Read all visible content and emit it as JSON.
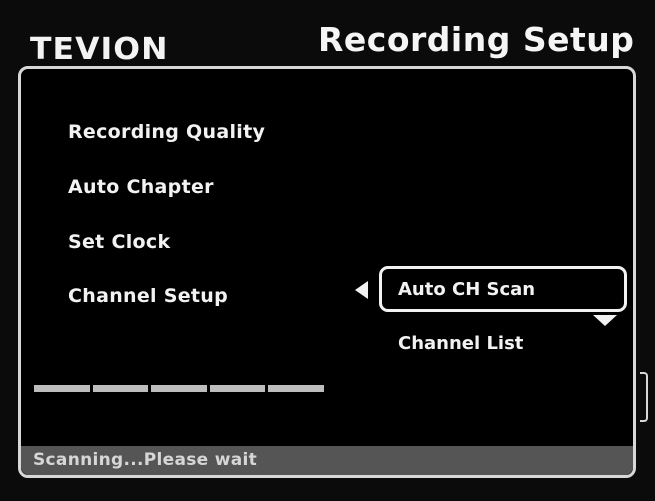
{
  "header": {
    "logo": "TEVION",
    "title": "Recording Setup"
  },
  "menu": {
    "items": [
      {
        "label": "Recording Quality"
      },
      {
        "label": "Auto Chapter"
      },
      {
        "label": "Set Clock"
      },
      {
        "label": "Channel Setup"
      }
    ]
  },
  "submenu": {
    "selected_label": "Auto CH Scan",
    "items": [
      {
        "label": "Auto CH Scan"
      },
      {
        "label": "Channel List"
      }
    ]
  },
  "progress": {
    "segments_total": 5,
    "segments_filled": 5
  },
  "status": {
    "text": "Scanning...Please wait"
  },
  "colors": {
    "background": "#000000",
    "text": "#f2f2f2",
    "status_bar": "#555555"
  }
}
